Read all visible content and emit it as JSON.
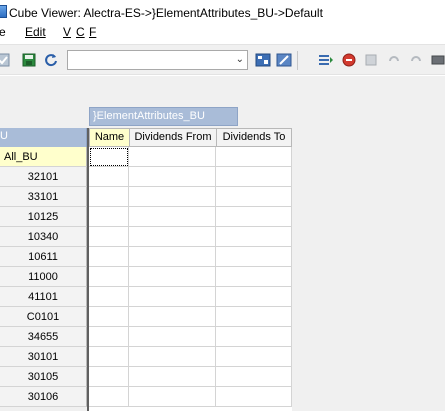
{
  "window": {
    "title": "Cube Viewer: Alectra-ES->}ElementAttributes_BU->Default"
  },
  "menu": {
    "items": [
      "e",
      "Edit",
      "V",
      "C",
      "F"
    ]
  },
  "toolbar": {
    "view_combo_value": ""
  },
  "column_dimension": {
    "label": "}ElementAttributes_BU"
  },
  "row_dimension": {
    "label": "U"
  },
  "columns": [
    "Name",
    "Dividends From",
    "Dividends To"
  ],
  "rows": [
    "All_BU",
    "32101",
    "33101",
    "10125",
    "10340",
    "10611",
    "11000",
    "41101",
    "C0101",
    "34655",
    "30101",
    "30105",
    "30106"
  ],
  "colors": {
    "dimension_tab": "#a9bcd8",
    "selected_header": "#ffffcc",
    "toolbar_bg": "#f0f0f0"
  }
}
